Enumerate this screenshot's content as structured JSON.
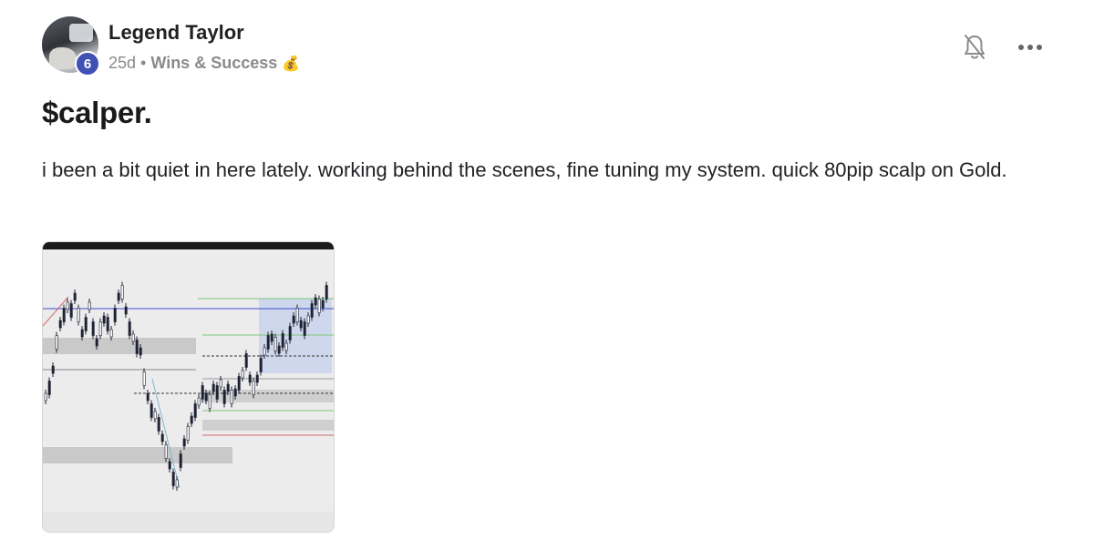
{
  "author": {
    "name": "Legend Taylor",
    "level": "6"
  },
  "meta": {
    "time": "25d",
    "separator": "•",
    "category": "Wins & Success",
    "category_emoji": "💰"
  },
  "actions": {
    "notify_icon": "bell-off-icon",
    "more_icon": "more-horizontal-icon"
  },
  "post": {
    "title": "$calper.",
    "body": "i been a bit quiet in here lately. working behind the scenes, fine tuning my system. quick 80pip scalp on Gold."
  },
  "attachment": {
    "type": "image",
    "description_icon": "trading-chart-thumbnail"
  },
  "colors": {
    "level_badge": "#3f51b5",
    "meta_text": "#8a8a8a",
    "candle": "#1e2233",
    "chart_bg": "#ececec"
  }
}
